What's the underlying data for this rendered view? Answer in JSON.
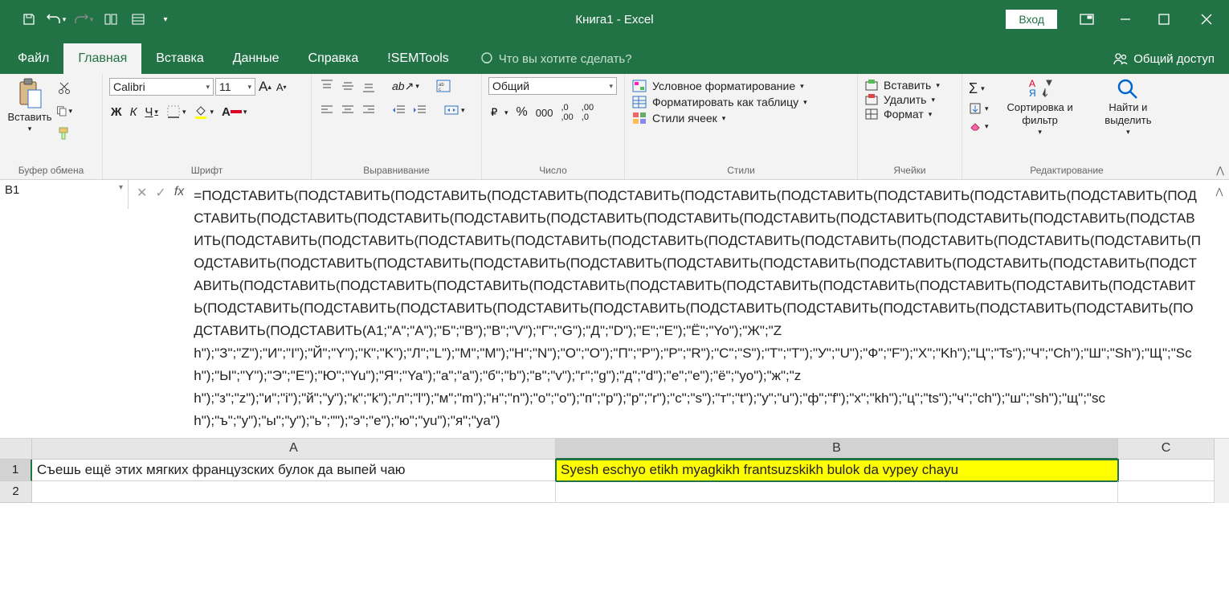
{
  "title": "Книга1  -  Excel",
  "login": "Вход",
  "tabs": {
    "file": "Файл",
    "home": "Главная",
    "insert": "Вставка",
    "data": "Данные",
    "help": "Справка",
    "semtools": "!SEMTools",
    "tellme": "Что вы хотите сделать?",
    "share": "Общий доступ"
  },
  "ribbon": {
    "clipboard": {
      "paste": "Вставить",
      "label": "Буфер обмена"
    },
    "font": {
      "name": "Calibri",
      "size": "11",
      "bold": "Ж",
      "italic": "К",
      "underline": "Ч",
      "label": "Шрифт"
    },
    "alignment": {
      "label": "Выравнивание"
    },
    "number": {
      "format": "Общий",
      "label": "Число"
    },
    "styles": {
      "cond": "Условное форматирование",
      "table": "Форматировать как таблицу",
      "cell": "Стили ячеек",
      "label": "Стили"
    },
    "cells": {
      "insert": "Вставить",
      "delete": "Удалить",
      "format": "Формат",
      "label": "Ячейки"
    },
    "editing": {
      "sort": "Сортировка и фильтр",
      "find": "Найти и выделить",
      "label": "Редактирование"
    }
  },
  "namebox": "B1",
  "formula": "=ПОДСТАВИТЬ(ПОДСТАВИТЬ(ПОДСТАВИТЬ(ПОДСТАВИТЬ(ПОДСТАВИТЬ(ПОДСТАВИТЬ(ПОДСТАВИТЬ(ПОДСТАВИТЬ(ПОДСТАВИТЬ(ПОДСТАВИТЬ(ПОДСТАВИТЬ(ПОДСТАВИТЬ(ПОДСТАВИТЬ(ПОДСТАВИТЬ(ПОДСТАВИТЬ(ПОДСТАВИТЬ(ПОДСТАВИТЬ(ПОДСТАВИТЬ(ПОДСТАВИТЬ(ПОДСТАВИТЬ(ПОДСТАВИТЬ(ПОДСТАВИТЬ(ПОДСТАВИТЬ(ПОДСТАВИТЬ(ПОДСТАВИТЬ(ПОДСТАВИТЬ(ПОДСТАВИТЬ(ПОДСТАВИТЬ(ПОДСТАВИТЬ(ПОДСТАВИТЬ(ПОДСТАВИТЬ(ПОДСТАВИТЬ(ПОДСТАВИТЬ(ПОДСТАВИТЬ(ПОДСТАВИТЬ(ПОДСТАВИТЬ(ПОДСТАВИТЬ(ПОДСТАВИТЬ(ПОДСТАВИТЬ(ПОДСТАВИТЬ(ПОДСТАВИТЬ(ПОДСТАВИТЬ(ПОДСТАВИТЬ(ПОДСТАВИТЬ(ПОДСТАВИТЬ(ПОДСТАВИТЬ(ПОДСТАВИТЬ(ПОДСТАВИТЬ(ПОДСТАВИТЬ(ПОДСТАВИТЬ(ПОДСТАВИТЬ(ПОДСТАВИТЬ(ПОДСТАВИТЬ(ПОДСТАВИТЬ(ПОДСТАВИТЬ(ПОДСТАВИТЬ(ПОДСТАВИТЬ(ПОДСТАВИТЬ(ПОДСТАВИТЬ(ПОДСТАВИТЬ(ПОДСТАВИТЬ(ПОДСТАВИТЬ(ПОДСТАВИТЬ(ПОДСТАВИТЬ(A1;\"А\";\"A\");\"Б\";\"B\");\"В\";\"V\");\"Г\";\"G\");\"Д\";\"D\");\"Е\";\"E\");\"Ё\";\"Yo\");\"Ж\";\"Zh\");\"З\";\"Z\");\"И\";\"I\");\"Й\";\"Y\");\"К\";\"K\");\"Л\";\"L\");\"М\";\"M\");\"Н\";\"N\");\"О\";\"O\");\"П\";\"P\");\"Р\";\"R\");\"С\";\"S\");\"Т\";\"T\");\"У\";\"U\");\"Ф\";\"F\");\"Х\";\"Kh\");\"Ц\";\"Ts\");\"Ч\";\"Ch\");\"Ш\";\"Sh\");\"Щ\";\"Sch\");\"Ы\";\"Y\");\"Э\";\"E\");\"Ю\";\"Yu\");\"Я\";\"Ya\");\"а\";\"a\");\"б\";\"b\");\"в\";\"v\");\"г\";\"g\");\"д\";\"d\");\"е\";\"e\");\"ё\";\"yo\");\"ж\";\"zh\");\"з\";\"z\");\"и\";\"i\");\"й\";\"y\");\"к\";\"k\");\"л\";\"l\");\"м\";\"m\");\"н\";\"n\");\"о\";\"o\");\"п\";\"p\");\"р\";\"r\");\"с\";\"s\");\"т\";\"t\");\"у\";\"u\");\"ф\";\"f\");\"х\";\"kh\");\"ц\";\"ts\");\"ч\";\"ch\");\"ш\";\"sh\");\"щ\";\"sch\");\"ъ\";\"y\");\"ы\";\"y\");\"ь\";\"\");\"э\";\"e\");\"ю\";\"yu\");\"я\";\"ya\")",
  "sheet": {
    "colA": "A",
    "colB": "B",
    "colC": "C",
    "row1": "1",
    "row2": "2",
    "a1": "Съешь ещё этих мягких французских булок да выпей чаю",
    "b1": "Syesh eschyo etikh myagkikh frantsuzskikh bulok da vypey chayu"
  }
}
